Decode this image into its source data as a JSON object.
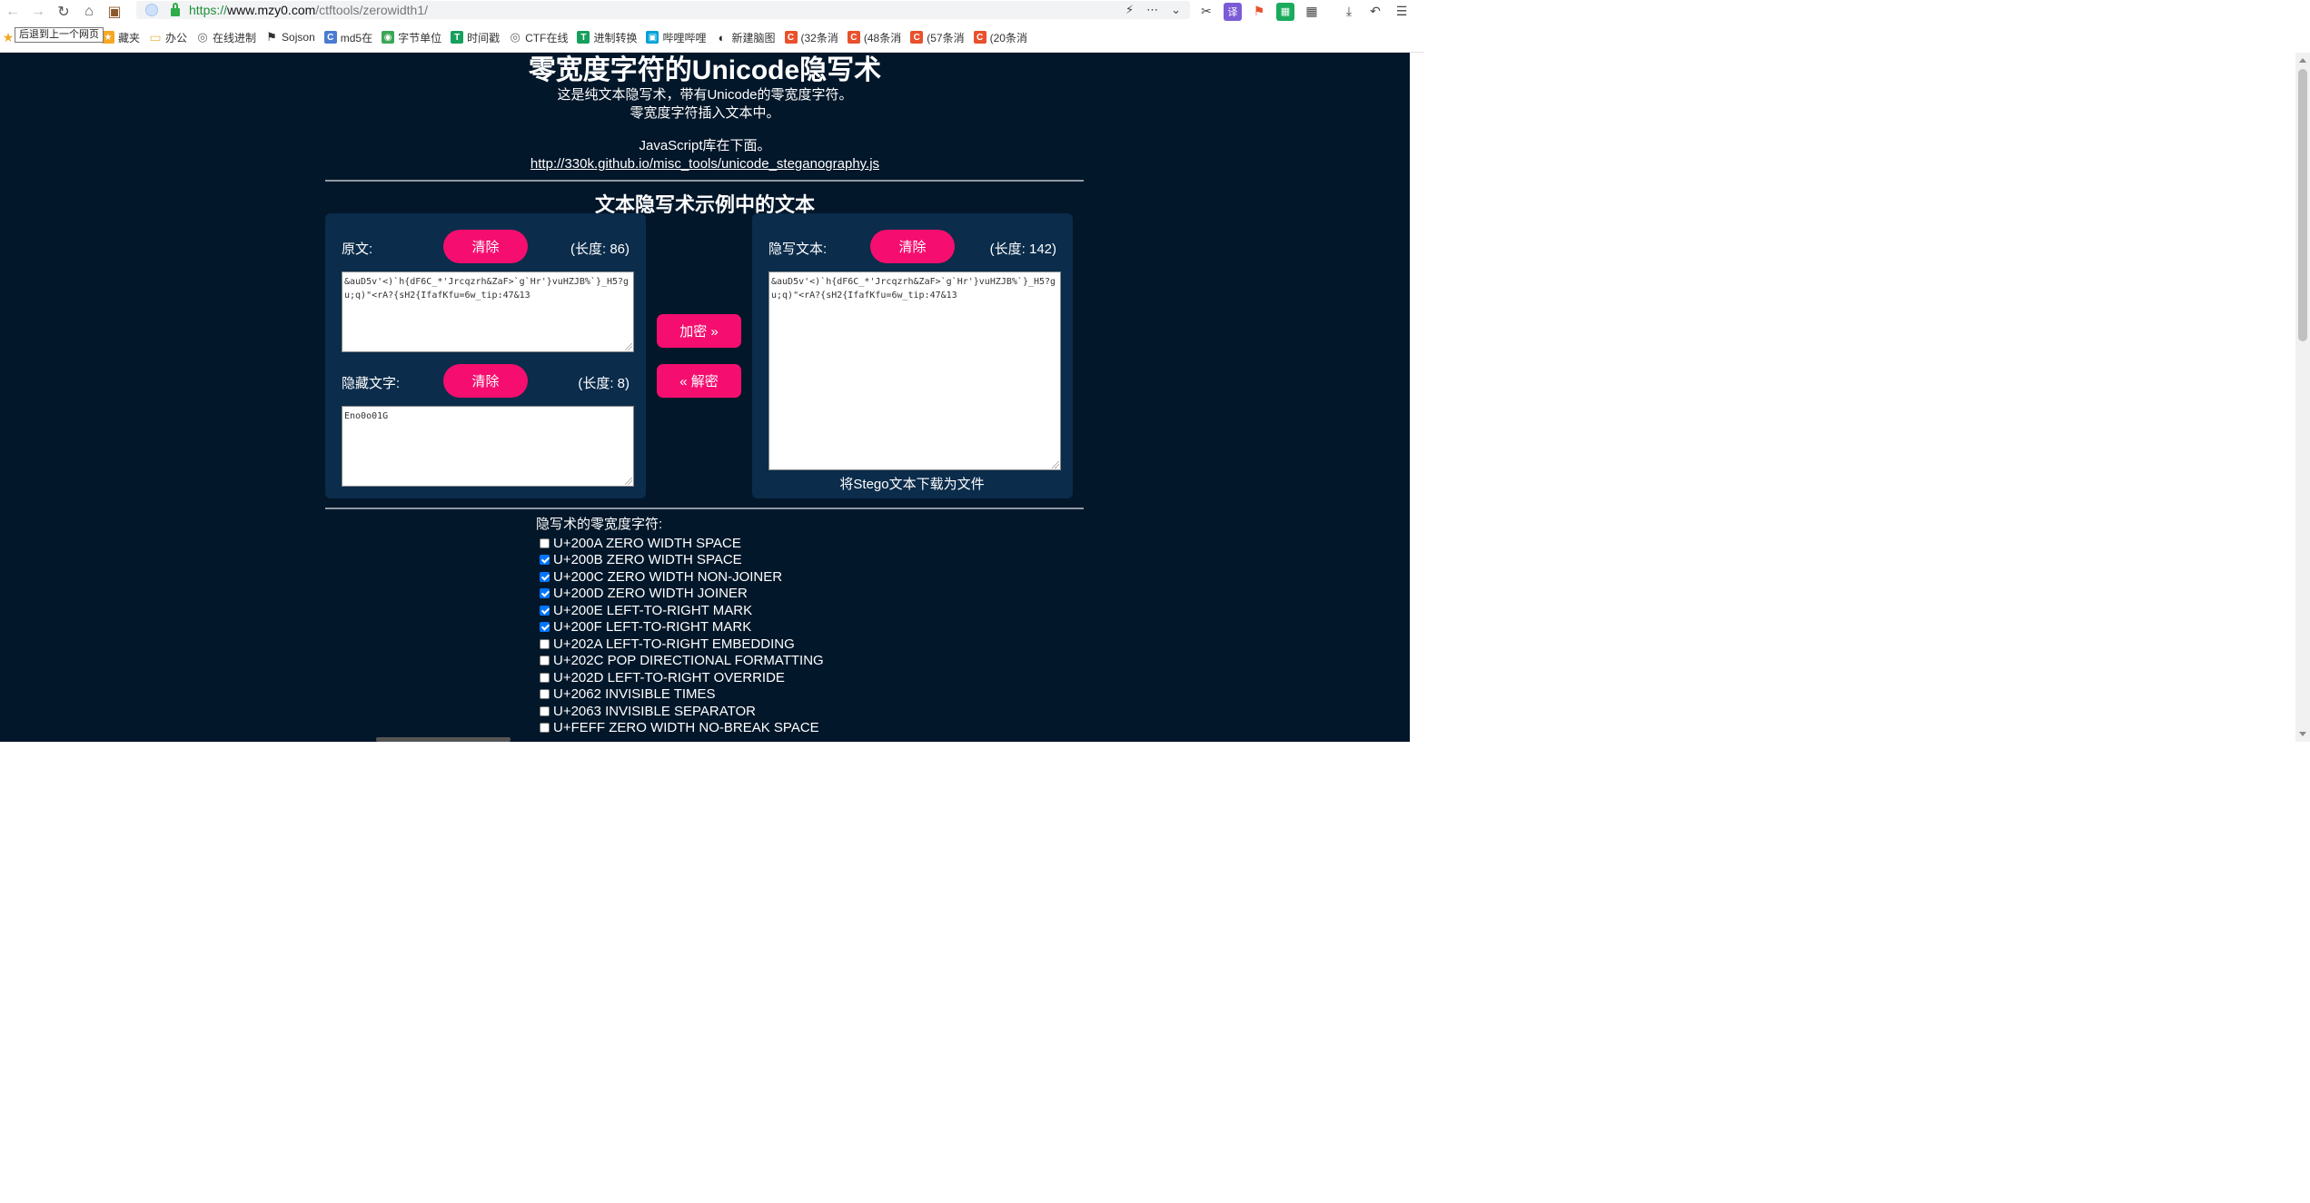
{
  "browser": {
    "url_scheme": "https://",
    "url_host": "www.mzy0.com",
    "url_path": "/ctftools/zerowidth1/",
    "tooltip": "后退到上一个网页",
    "bookmarks": [
      {
        "label": "藏夹",
        "icon": "star-icon",
        "color": "#f5a623"
      },
      {
        "label": "办公",
        "icon": "folder-icon",
        "color": "#e8b84a"
      },
      {
        "label": "在线进制",
        "icon": "globe-icon",
        "color": "#666666"
      },
      {
        "label": "Sojson",
        "icon": "flag-icon",
        "color": "#333333"
      },
      {
        "label": "md5在",
        "icon": "site-icon",
        "color": "#4a7bd0"
      },
      {
        "label": "字节单位",
        "icon": "swirl-icon",
        "color": "#3aa655"
      },
      {
        "label": "时间戳",
        "icon": "tool-icon",
        "color": "#17a05d"
      },
      {
        "label": "CTF在线",
        "icon": "globe-icon",
        "color": "#666666"
      },
      {
        "label": "进制转换",
        "icon": "tool-icon",
        "color": "#17a05d"
      },
      {
        "label": "哔哩哔哩",
        "icon": "tv-icon",
        "color": "#00a1d6"
      },
      {
        "label": "新建脑图",
        "icon": "mask-icon",
        "color": "#222222"
      },
      {
        "label": "(32条消",
        "icon": "csdn-icon",
        "color": "#e8512c"
      },
      {
        "label": "(48条消",
        "icon": "csdn-icon",
        "color": "#e8512c"
      },
      {
        "label": "(57条消",
        "icon": "csdn-icon",
        "color": "#e8512c"
      },
      {
        "label": "(20条消",
        "icon": "csdn-icon",
        "color": "#e8512c"
      }
    ]
  },
  "hero": {
    "title": "零宽度字符的Unicode隐写术",
    "line1": "这是纯文本隐写术，带有Unicode的零宽度字符。",
    "line2": "零宽度字符插入文本中。",
    "line3": "JavaScript库在下面。",
    "link": "http://330k.github.io/misc_tools/unicode_steganography.js"
  },
  "section_title": "文本隐写术示例中的文本",
  "left_panel": {
    "original_label": "原文:",
    "clear_label": "清除",
    "original_length": "(长度: 86)",
    "original_text": "&auD5v'<)`h{dF6C_*'Jrcqzrh&ZaF>`g`Hr'}vuHZJB%`}_H5?gu;q)\"<rA?{sH2{IfafKfu=6w_tip:47&13",
    "hidden_label": "隐藏文字:",
    "hidden_length": "(长度: 8)",
    "hidden_text": "Eno0o01G"
  },
  "middle": {
    "encode_label": "加密 »",
    "decode_label": "« 解密"
  },
  "right_panel": {
    "stego_label": "隐写文本:",
    "clear_label": "清除",
    "stego_length": "(长度: 142)",
    "stego_text": "&auD5v'<)`h{dF6C_*'Jrcqzrh&ZaF>`g`Hr'}vuHZJB%`}_H5?gu;q)\"<rA?{sH2{IfafKfu=6w_tip:47&13",
    "download_label": "将Stego文本下载为文件"
  },
  "zero_width": {
    "title": "隐写术的零宽度字符:",
    "options": [
      {
        "label": "U+200A ZERO WIDTH SPACE",
        "checked": false
      },
      {
        "label": "U+200B ZERO WIDTH SPACE",
        "checked": true
      },
      {
        "label": "U+200C ZERO WIDTH NON-JOINER",
        "checked": true
      },
      {
        "label": "U+200D ZERO WIDTH JOINER",
        "checked": true
      },
      {
        "label": "U+200E LEFT-TO-RIGHT MARK",
        "checked": true
      },
      {
        "label": "U+200F LEFT-TO-RIGHT MARK",
        "checked": true
      },
      {
        "label": "U+202A LEFT-TO-RIGHT EMBEDDING",
        "checked": false
      },
      {
        "label": "U+202C POP DIRECTIONAL FORMATTING",
        "checked": false
      },
      {
        "label": "U+202D LEFT-TO-RIGHT OVERRIDE",
        "checked": false
      },
      {
        "label": "U+2062 INVISIBLE TIMES",
        "checked": false
      },
      {
        "label": "U+2063 INVISIBLE SEPARATOR",
        "checked": false
      },
      {
        "label": "U+FEFF ZERO WIDTH NO-BREAK SPACE",
        "checked": false
      }
    ]
  },
  "colors": {
    "page_bg": "#03172a",
    "panel_bg": "#0b2c4b",
    "accent": "#f50e6f"
  }
}
